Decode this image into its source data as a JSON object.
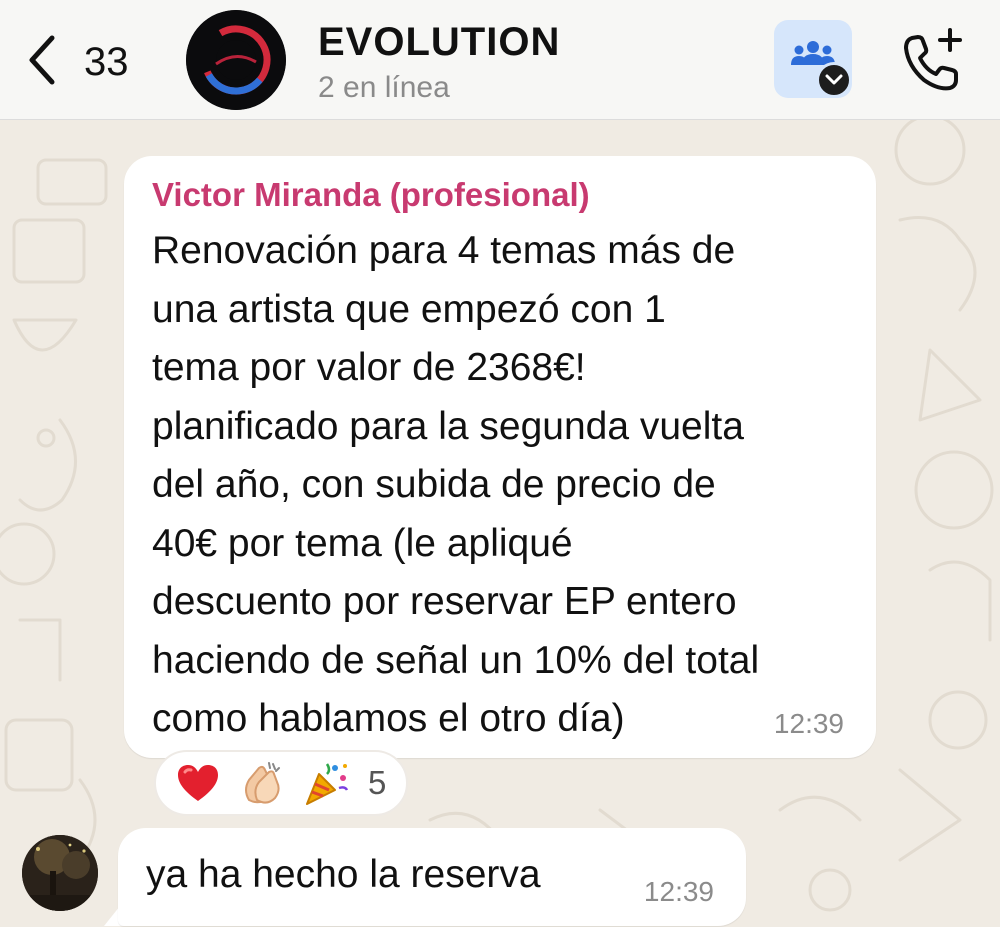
{
  "header": {
    "back_count": "33",
    "title": "EVOLUTION",
    "subtitle": "2 en línea",
    "icons": {
      "back": "chevron-left-icon",
      "community": "community-icon",
      "call": "add-call-icon"
    }
  },
  "messages": [
    {
      "sender": "Victor Miranda (profesional)",
      "text": "Renovación para 4 temas más de\nuna artista que empezó con 1\ntema por valor de 2368€!\nplanificado para la segunda vuelta\ndel año, con subida de precio de\n40€ por tema (le apliqué\ndescuento por reservar EP entero\nhaciendo de señal un 10% del total\ncomo hablamos el otro día)",
      "time": "12:39",
      "reactions": {
        "emojis": [
          "heart",
          "clapping-hands",
          "party-popper"
        ],
        "count": "5"
      }
    },
    {
      "text": "ya ha hecho la reserva",
      "time": "12:39"
    }
  ],
  "colors": {
    "sender_name": "#c83a70",
    "header_bg": "#f7f7f5",
    "chat_bg": "#f0ebe3",
    "bubble_bg": "#ffffff",
    "community_btn_bg": "#d6e6fb",
    "community_icon": "#2d6cd8"
  }
}
